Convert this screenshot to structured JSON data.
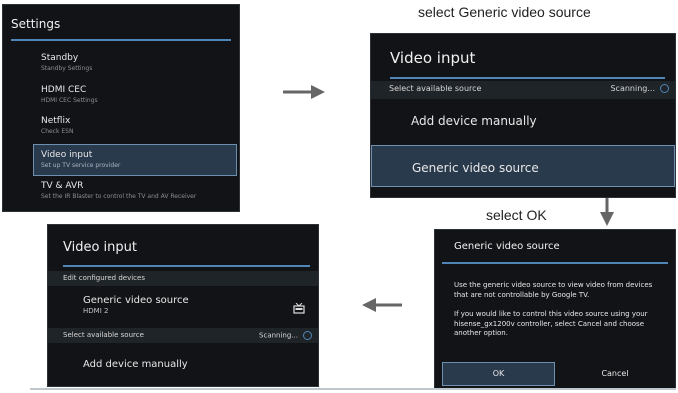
{
  "captions": {
    "select_generic": "select Generic video source",
    "select_ok": "select OK"
  },
  "settings_screen": {
    "title": "Settings",
    "items": [
      {
        "label": "Standby",
        "sub": "Standby Settings"
      },
      {
        "label": "HDMI CEC",
        "sub": "HDMI CEC Settings"
      },
      {
        "label": "Netflix",
        "sub": "Check ESN"
      },
      {
        "label": "Video input",
        "sub": "Set up TV service provider"
      },
      {
        "label": "TV & AVR",
        "sub": "Set the IR Blaster to control the TV and AV Receiver"
      }
    ]
  },
  "video_input_screen": {
    "title": "Video input",
    "section": "Select available source",
    "status": "Scanning...",
    "items": [
      "Add device manually",
      "Generic video source"
    ]
  },
  "dialog_screen": {
    "title": "Generic video source",
    "body1": "Use the generic video source to view video from devices that are not controllable by Google TV.",
    "body2": "If you would like to control this video source using your hisense_gx1200v controller, select Cancel and choose another option.",
    "ok": "OK",
    "cancel": "Cancel"
  },
  "result_screen": {
    "title": "Video input",
    "section1": "Edit configured devices",
    "device_name": "Generic video source",
    "device_sub": "HDMI 2",
    "section2": "Select available source",
    "status": "Scanning...",
    "item": "Add device manually"
  },
  "colors": {
    "accent": "#4f86b7",
    "selected": "#2a3a4d"
  }
}
